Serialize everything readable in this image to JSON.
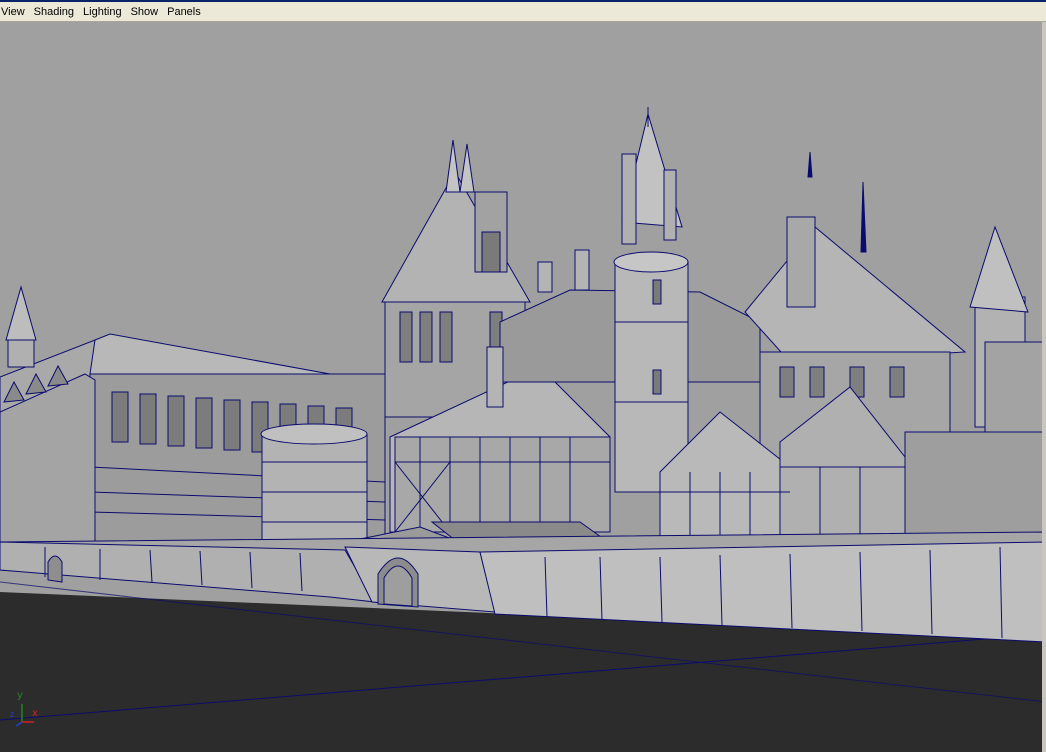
{
  "menubar": {
    "items": [
      {
        "label": "View"
      },
      {
        "label": "Shading"
      },
      {
        "label": "Lighting"
      },
      {
        "label": "Show"
      },
      {
        "label": "Panels"
      }
    ]
  },
  "viewport": {
    "background": "#a0a0a0",
    "ground": "#2c2c2c",
    "wireframe": "#0b0b6e",
    "surface": "#a9a9a9",
    "axis_gizmo": {
      "x": "x",
      "y": "y",
      "z": "z"
    }
  }
}
